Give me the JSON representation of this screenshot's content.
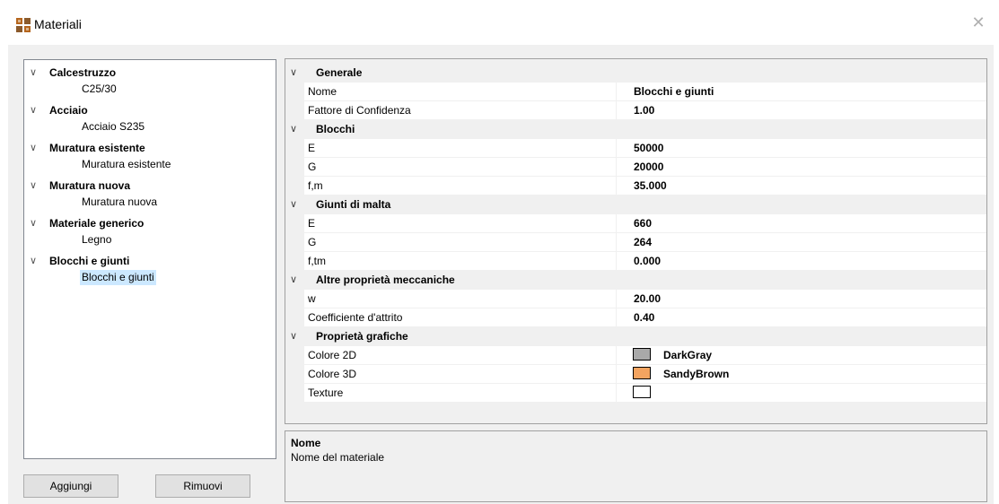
{
  "window": {
    "title": "Materiali"
  },
  "tree": [
    {
      "label": "Calcestruzzo",
      "children": [
        "C25/30"
      ]
    },
    {
      "label": "Acciaio",
      "children": [
        "Acciaio S235"
      ]
    },
    {
      "label": "Muratura esistente",
      "children": [
        "Muratura esistente"
      ]
    },
    {
      "label": "Muratura nuova",
      "children": [
        "Muratura nuova"
      ]
    },
    {
      "label": "Materiale generico",
      "children": [
        "Legno"
      ]
    },
    {
      "label": "Blocchi e giunti",
      "children": [
        "Blocchi e giunti"
      ]
    }
  ],
  "selected_item": "Blocchi e giunti",
  "buttons": {
    "add": "Aggiungi",
    "remove": "Rimuovi"
  },
  "grid": {
    "categories": [
      {
        "title": "Generale",
        "props": [
          {
            "name": "Nome",
            "value": "Blocchi e giunti"
          },
          {
            "name": "Fattore di Confidenza",
            "value": "1.00"
          }
        ]
      },
      {
        "title": "Blocchi",
        "props": [
          {
            "name": "E",
            "value": "50000"
          },
          {
            "name": "G",
            "value": "20000"
          },
          {
            "name": "f,m",
            "value": "35.000"
          }
        ]
      },
      {
        "title": "Giunti di malta",
        "props": [
          {
            "name": "E",
            "value": "660"
          },
          {
            "name": "G",
            "value": "264"
          },
          {
            "name": "f,tm",
            "value": "0.000"
          }
        ]
      },
      {
        "title": "Altre proprietà meccaniche",
        "props": [
          {
            "name": "w",
            "value": "20.00"
          },
          {
            "name": "Coefficiente d'attrito",
            "value": "0.40"
          }
        ]
      },
      {
        "title": "Proprietà grafiche",
        "props": [
          {
            "name": "Colore 2D",
            "value": "DarkGray",
            "color": "#a9a9a9"
          },
          {
            "name": "Colore 3D",
            "value": "SandyBrown",
            "color": "#f4a460"
          },
          {
            "name": "Texture",
            "value": "",
            "color": "#ffffff"
          }
        ]
      }
    ]
  },
  "help": {
    "title": "Nome",
    "description": "Nome del materiale"
  }
}
